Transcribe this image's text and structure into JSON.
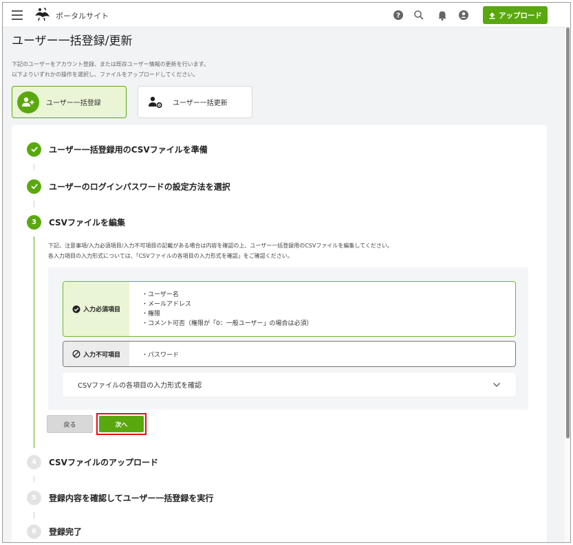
{
  "header": {
    "site_name": "ポータルサイト",
    "upload_label": "アップロード"
  },
  "page": {
    "title": "ユーザー一括登録/更新",
    "description_1": "下記のユーザーをアカウント登録、または既存ユーザー情報の更新を行います。",
    "description_2": "以下よりいずれかの操作を選択し、ファイルをアップロードしてください。"
  },
  "modes": {
    "register": "ユーザー一括登録",
    "update": "ユーザー一括更新"
  },
  "steps": [
    {
      "number": "1",
      "title": "ユーザー一括登録用のCSVファイルを準備",
      "status": "done"
    },
    {
      "number": "2",
      "title": "ユーザーのログインパスワードの設定方法を選択",
      "status": "done"
    },
    {
      "number": "3",
      "title": "CSVファイルを編集",
      "status": "active"
    },
    {
      "number": "4",
      "title": "CSVファイルのアップロード",
      "status": "pending"
    },
    {
      "number": "5",
      "title": "登録内容を確認してユーザー一括登録を実行",
      "status": "pending"
    },
    {
      "number": "6",
      "title": "登録完了",
      "status": "pending"
    }
  ],
  "step3": {
    "desc_1": "下記、注意事項/入力必須項目/入力不可項目の記載がある場合は内容を確認の上、ユーザー一括登録用のCSVファイルを編集してください。",
    "desc_2": "各入力項目の入力形式については、「CSVファイルの各項目の入力形式を確認」をご確認ください。",
    "required_label": "入力必須項目",
    "required_items": [
      "・ユーザー名",
      "・メールアドレス",
      "・権限",
      "・コメント可否（権限が「0：一般ユーザー」の場合は必須）"
    ],
    "prohibited_label": "入力不可項目",
    "prohibited_items": [
      "・パスワード"
    ],
    "accordion_label": "CSVファイルの各項目の入力形式を確認",
    "back_label": "戻る",
    "next_label": "次へ"
  },
  "colors": {
    "accent": "#5aa80f",
    "highlight": "#e01010"
  }
}
